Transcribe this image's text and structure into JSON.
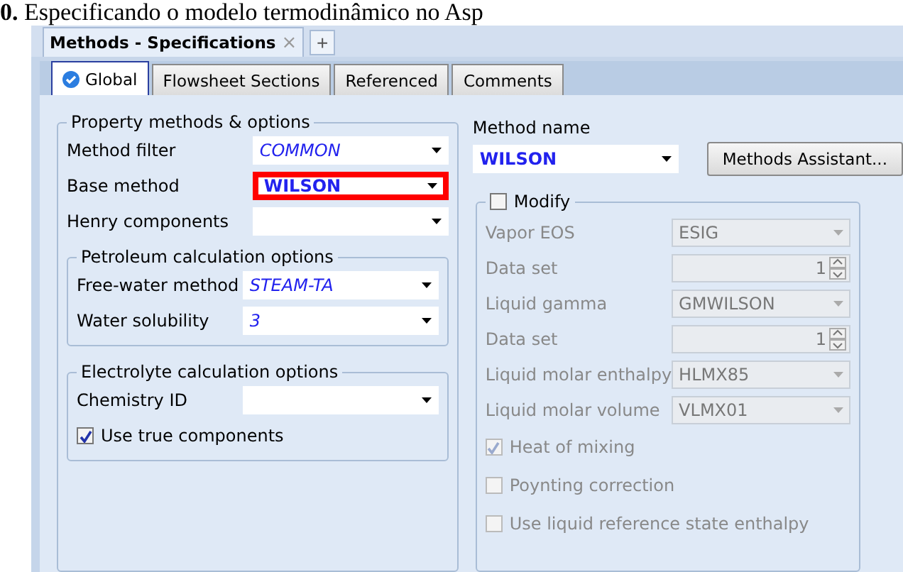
{
  "caption": "**0.** Especificando o modelo termodinâmico no Asp",
  "document_tabs": [
    {
      "label": "Methods - Specifications",
      "selected": true,
      "close": "×"
    }
  ],
  "add_tab": "+",
  "tabs": [
    {
      "label": "Global",
      "selected": true,
      "done": true
    },
    {
      "label": "Flowsheet Sections",
      "selected": false,
      "done": false
    },
    {
      "label": "Referenced",
      "selected": false,
      "done": false
    },
    {
      "label": "Comments",
      "selected": false,
      "done": false
    }
  ],
  "property_methods": {
    "title": "Property methods & options",
    "fields": [
      {
        "label": "Method filter",
        "value": "COMMON",
        "kind": "default",
        "highlighted": false
      },
      {
        "label": "Base method",
        "value": "WILSON",
        "kind": "user",
        "highlighted": true
      },
      {
        "label": "Henry components",
        "highlighted": false
      }
    ]
  },
  "petroleum": {
    "title": "Petroleum calculation options",
    "fields": [
      {
        "label": "Free-water method",
        "value": "STEAM-TA",
        "kind": "default",
        "highlighted": false
      },
      {
        "label": "Water solubility",
        "value": "3",
        "kind": "default",
        "highlighted": false
      }
    ]
  },
  "electrolyte": {
    "title": "Electrolyte calculation options",
    "fields": [
      {
        "label": "Chemistry ID",
        "highlighted": false
      }
    ],
    "checkbox": {
      "label": "Use true components",
      "checked": true
    }
  },
  "method_name": {
    "label": "Method name",
    "value": "WILSON"
  },
  "methods_assistant": "Methods Assistant...",
  "modify": {
    "label": "Modify",
    "checked": false,
    "rows": [
      {
        "kind": "select",
        "label": "Vapor EOS",
        "value": "ESIG"
      },
      {
        "kind": "spinner",
        "label": "Data set",
        "value": "1"
      },
      {
        "kind": "select",
        "label": "Liquid gamma",
        "value": "GMWILSON"
      },
      {
        "kind": "spinner",
        "label": "Data set",
        "value": "1"
      },
      {
        "kind": "select",
        "label": "Liquid molar enthalpy",
        "value": "HLMX85"
      },
      {
        "kind": "select",
        "label": "Liquid molar volume",
        "value": "VLMX01"
      }
    ],
    "options": [
      {
        "label": "Heat of mixing",
        "checked": true
      },
      {
        "label": "Poynting correction",
        "checked": false
      },
      {
        "label": "Use liquid reference state enthalpy",
        "checked": false
      }
    ]
  }
}
